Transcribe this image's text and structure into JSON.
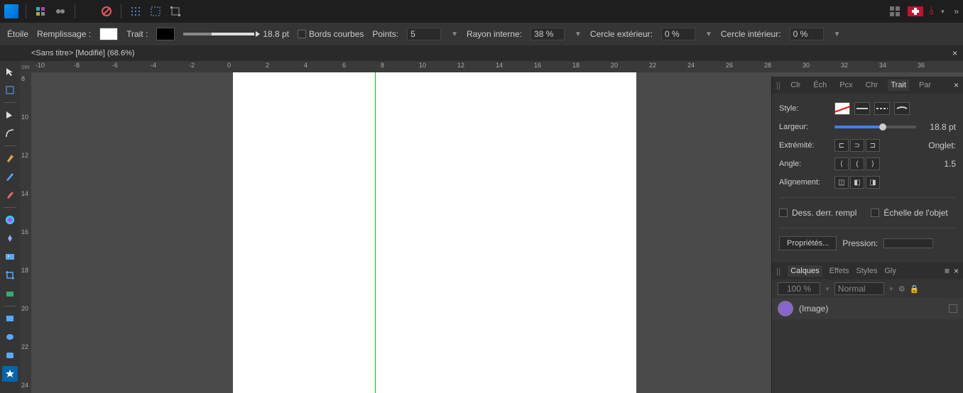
{
  "context": {
    "tool_name": "Étoile",
    "fill_label": "Remplissage :",
    "stroke_label": "Trait :",
    "stroke_width": "18.8 pt",
    "curved_edges_label": "Bords courbes",
    "points_label": "Points:",
    "points_value": "5",
    "inner_radius_label": "Rayon interne:",
    "inner_radius_value": "38 %",
    "outer_circle_label": "Cercle extérieur:",
    "outer_circle_value": "0 %",
    "inner_circle_label": "Cercle intérieur:",
    "inner_circle_value": "0 %"
  },
  "doc": {
    "title": "<Sans titre> [Modifié] (68.6%)",
    "ruler_unit": "cm"
  },
  "hruler_labels": [
    "-10",
    "-8",
    "-6",
    "-4",
    "-2",
    "0",
    "2",
    "4",
    "6",
    "8",
    "10",
    "12",
    "14",
    "16",
    "18",
    "20",
    "22",
    "24",
    "26",
    "28",
    "30",
    "32",
    "34",
    "36"
  ],
  "vruler_labels": [
    "8",
    "10",
    "12",
    "14",
    "16",
    "18",
    "20",
    "22",
    "24"
  ],
  "panel": {
    "tabs": [
      "Clr",
      "Éch",
      "Pcx",
      "Chr",
      "Trait",
      "Par"
    ],
    "style_label": "Style:",
    "width_label": "Largeur:",
    "width_value": "18.8 pt",
    "cap_label": "Extrémité:",
    "miter_label": "Onglet:",
    "join_label": "Angle:",
    "miter_value": "1.5",
    "align_label": "Alignement:",
    "draw_behind_label": "Dess. derr. rempl",
    "scale_obj_label": "Échelle de l'objet",
    "properties_btn": "Propriétés...",
    "pressure_label": "Pression:"
  },
  "layers": {
    "tabs": [
      "Calques",
      "Effets",
      "Styles",
      "Gly"
    ],
    "opacity": "100 %",
    "blend": "Normal",
    "item_name": "(Image)"
  }
}
